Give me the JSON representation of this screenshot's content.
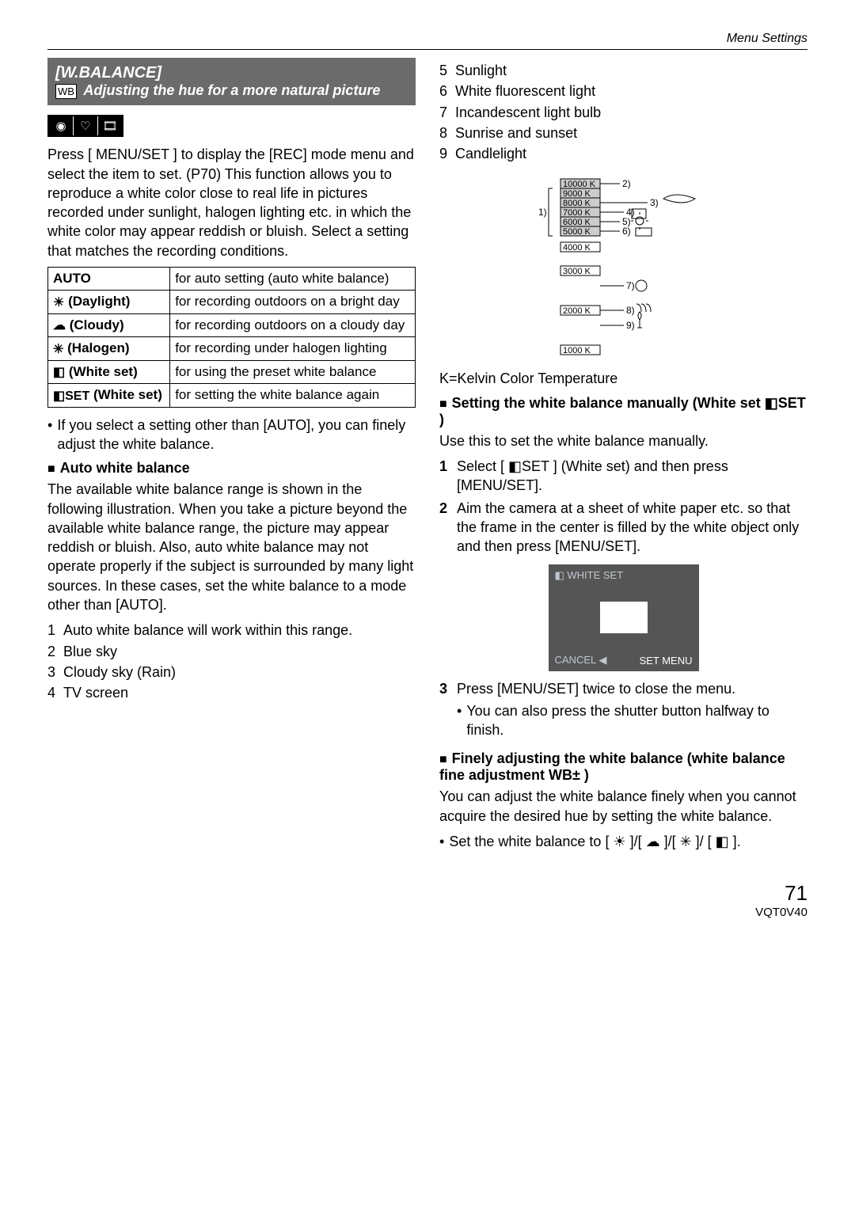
{
  "header": {
    "section": "Menu Settings"
  },
  "feature": {
    "title": "[W.BALANCE]",
    "wb_box": "WB",
    "desc": "Adjusting the hue for a more natural picture"
  },
  "intro": "Press [ MENU/SET ] to display the [REC] mode menu and select the item to set. (P70) This function allows you to reproduce a white color close to real life in pictures recorded under sunlight, halogen lighting etc. in which the white color may appear reddish or bluish. Select a setting that matches the recording conditions.",
  "table": [
    {
      "label": "AUTO",
      "icon": "",
      "desc": "for auto setting (auto white balance)"
    },
    {
      "label": "(Daylight)",
      "icon": "☀",
      "desc": "for recording outdoors on a bright day"
    },
    {
      "label": "(Cloudy)",
      "icon": "☁",
      "desc": "for recording outdoors on a cloudy day"
    },
    {
      "label": "(Halogen)",
      "icon": "✳",
      "desc": "for recording under halogen lighting"
    },
    {
      "label": "(White set)",
      "icon": "◧",
      "desc": "for using the preset white balance"
    },
    {
      "label": "(White set)",
      "icon": "◧SET",
      "desc": "for setting the white balance again"
    }
  ],
  "note_after_table": "If you select a setting other than [AUTO], you can finely adjust the white balance.",
  "awb": {
    "heading": "Auto white balance",
    "body": "The available white balance range is shown in the following illustration. When you take a picture beyond the available white balance range, the picture may appear reddish or bluish. Also, auto white balance may not operate properly if the subject is surrounded by many light sources. In these cases, set the white balance to a mode other than [AUTO]."
  },
  "legend_left": [
    "Auto white balance will work within this range.",
    "Blue sky",
    "Cloudy sky (Rain)",
    "TV screen"
  ],
  "legend_right": [
    "Sunlight",
    "White fluorescent light",
    "Incandescent light bulb",
    "Sunrise and sunset",
    "Candlelight"
  ],
  "kelvin_caption": "K=Kelvin Color Temperature",
  "kelvin_ticks": [
    "10000 K",
    "9000 K",
    "8000 K",
    "7000 K",
    "6000 K",
    "5000 K",
    "4000 K",
    "3000 K",
    "2000 K",
    "1000 K"
  ],
  "manual": {
    "heading": "Setting the white balance manually (White set ◧SET )",
    "intro": "Use this to set the white balance manually.",
    "steps": [
      "Select [ ◧SET ] (White set) and then press [MENU/SET].",
      "Aim the camera at a sheet of white paper etc. so that the frame in the center is filled by the white object only and then press [MENU/SET]."
    ],
    "step3": "Press [MENU/SET] twice to close the menu.",
    "step3_sub": "You can also press the shutter button halfway to finish."
  },
  "screen": {
    "title": "◧ WHITE SET",
    "cancel": "CANCEL ◀",
    "set": "SET MENU"
  },
  "fine": {
    "heading": "Finely adjusting the white balance (white balance fine adjustment WB± )",
    "body": "You can adjust the white balance finely when you cannot acquire the desired hue by setting the white balance.",
    "bullet": "Set the white balance to [ ☀ ]/[ ☁ ]/[ ✳ ]/ [ ◧ ]."
  },
  "footer": {
    "page": "71",
    "docid": "VQT0V40"
  }
}
